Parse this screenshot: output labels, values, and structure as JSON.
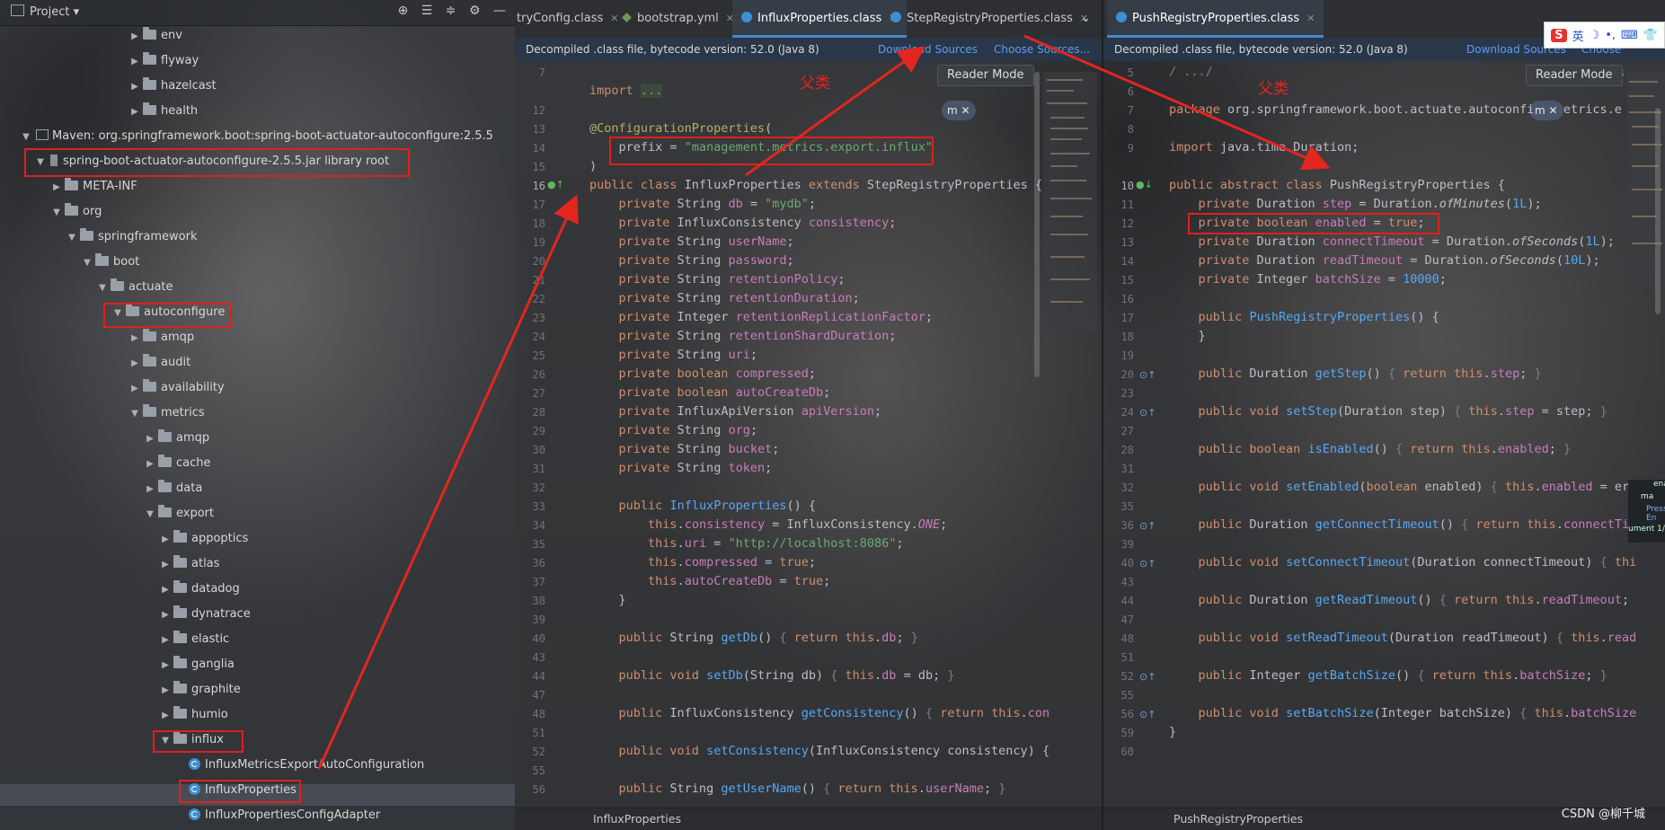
{
  "project": {
    "title": "Project",
    "tree": [
      {
        "label": "env"
      },
      {
        "label": "flyway"
      },
      {
        "label": "hazelcast"
      },
      {
        "label": "health"
      },
      {
        "label": "Maven: org.springframework.boot:spring-boot-actuator-autoconfigure:2.5.5"
      },
      {
        "label": "spring-boot-actuator-autoconfigure-2.5.5.jar  library root"
      },
      {
        "label": "META-INF"
      },
      {
        "label": "org"
      },
      {
        "label": "springframework"
      },
      {
        "label": "boot"
      },
      {
        "label": "actuate"
      },
      {
        "label": "autoconfigure"
      },
      {
        "label": "amqp"
      },
      {
        "label": "audit"
      },
      {
        "label": "availability"
      },
      {
        "label": "metrics"
      },
      {
        "label": "amqp"
      },
      {
        "label": "cache"
      },
      {
        "label": "data"
      },
      {
        "label": "export"
      },
      {
        "label": "appoptics"
      },
      {
        "label": "atlas"
      },
      {
        "label": "datadog"
      },
      {
        "label": "dynatrace"
      },
      {
        "label": "elastic"
      },
      {
        "label": "ganglia"
      },
      {
        "label": "graphite"
      },
      {
        "label": "humio"
      },
      {
        "label": "influx"
      },
      {
        "label": "InfluxMetricsExportAutoConfiguration"
      },
      {
        "label": "InfluxProperties"
      },
      {
        "label": "InfluxPropertiesConfigAdapter"
      }
    ]
  },
  "left_editor": {
    "tabs": [
      {
        "label": "tryConfig.class"
      },
      {
        "label": "bootstrap.yml"
      },
      {
        "label": "InfluxProperties.class"
      },
      {
        "label": "StepRegistryProperties.class"
      }
    ],
    "info": "Decompiled .class file, bytecode version: 52.0 (Java 8)",
    "download_sources": "Download Sources",
    "choose_sources": "Choose Sources...",
    "reader_mode": "Reader Mode",
    "annotation": "父类",
    "badge": "m",
    "breadcrumb": "InfluxProperties",
    "line_numbers": [
      "7",
      "12",
      "13",
      "14",
      "15",
      "16",
      "17",
      "18",
      "19",
      "20",
      "21",
      "22",
      "23",
      "24",
      "25",
      "26",
      "27",
      "28",
      "29",
      "30",
      "31",
      "32",
      "33",
      "34",
      "35",
      "36",
      "37",
      "38",
      "39",
      "40",
      "43",
      "44",
      "47",
      "48",
      "51",
      "52",
      "55",
      "56"
    ]
  },
  "right_editor": {
    "tabs": [
      {
        "label": "PushRegistryProperties.class"
      }
    ],
    "info": "Decompiled .class file, bytecode version: 52.0 (Java 8)",
    "download_sources": "Download Sources",
    "choose_sources": "Choose Sources",
    "reader_mode": "Reader Mode",
    "annotation": "父类",
    "badge": "m",
    "breadcrumb": "PushRegistryProperties",
    "line_numbers": [
      "5",
      "6",
      "7",
      "8",
      "9",
      "10",
      "11",
      "12",
      "13",
      "14",
      "15",
      "16",
      "17",
      "18",
      "19",
      "20",
      "23",
      "24",
      "27",
      "28",
      "31",
      "32",
      "35",
      "36",
      "39",
      "40",
      "43",
      "44",
      "47",
      "48",
      "51",
      "52",
      "55",
      "56",
      "59",
      "60"
    ],
    "popup_lines": [
      "ena",
      "ma",
      "Press En",
      "ument 1/"
    ]
  },
  "ime": {
    "logo": "S",
    "items": [
      "英",
      "☽",
      "•,",
      "⌨",
      "👕"
    ]
  },
  "watermark": "CSDN @柳千城"
}
